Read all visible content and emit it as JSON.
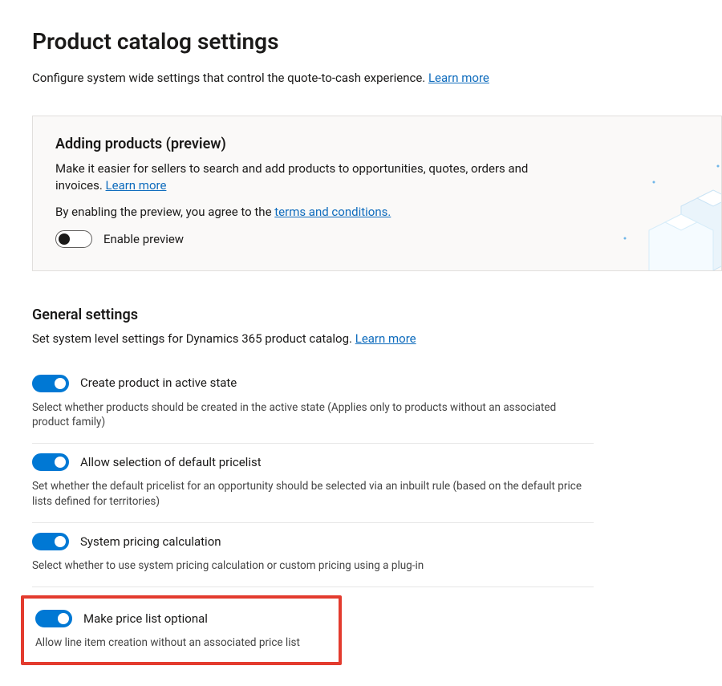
{
  "header": {
    "title": "Product catalog settings",
    "subtitle": "Configure system wide settings that control the quote-to-cash experience.",
    "learn_more": "Learn more"
  },
  "preview_card": {
    "title": "Adding products (preview)",
    "desc": "Make it easier for sellers to search and add products to opportunities, quotes, orders and invoices.",
    "learn_more": "Learn more",
    "agree_prefix": "By enabling the preview, you agree to the ",
    "terms_link": "terms and conditions.",
    "toggle_label": "Enable preview",
    "toggle_on": false
  },
  "general": {
    "title": "General settings",
    "subtitle": "Set system level settings for Dynamics 365 product catalog.",
    "learn_more": "Learn more",
    "settings": [
      {
        "label": "Create product in active state",
        "desc": "Select whether products should be created in the active state (Applies only to products without an associated product family)",
        "on": true
      },
      {
        "label": "Allow selection of default pricelist",
        "desc": "Set whether the default pricelist for an opportunity should be selected via an inbuilt rule (based on the default price lists defined for territories)",
        "on": true
      },
      {
        "label": "System pricing calculation",
        "desc": "Select whether to use system pricing calculation or custom pricing using a plug-in",
        "on": true
      }
    ],
    "highlighted": {
      "label": "Make price list optional",
      "desc": "Allow line item creation without an associated price list",
      "on": true
    }
  }
}
